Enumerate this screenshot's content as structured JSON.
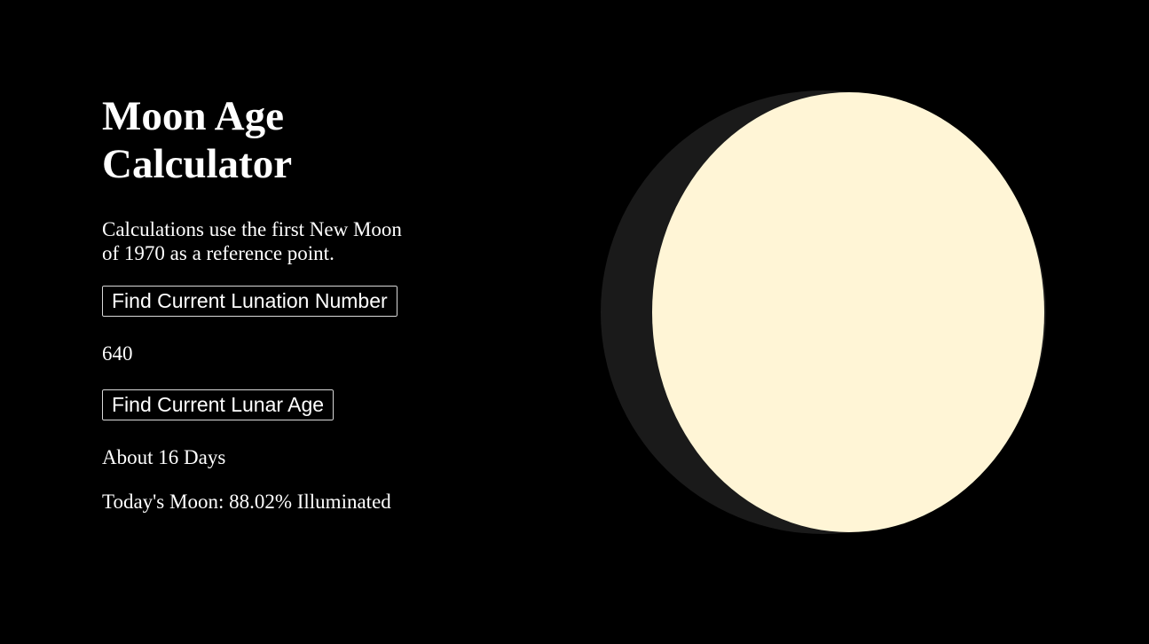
{
  "page": {
    "title": "Moon Age Calculator",
    "description": "Calculations use the first New Moon of 1970 as a reference point."
  },
  "lunation": {
    "button_label": "Find Current Lunation Number",
    "result": "640"
  },
  "lunar_age": {
    "button_label": "Find Current Lunar Age",
    "result": "About 16 Days"
  },
  "illumination": {
    "text": "Today's Moon: 88.02% Illuminated",
    "fraction": 0.8802
  },
  "colors": {
    "background": "#000000",
    "text": "#ffffff",
    "moon_lit": "#fff5d6",
    "moon_shadow": "#1a1a1a"
  }
}
